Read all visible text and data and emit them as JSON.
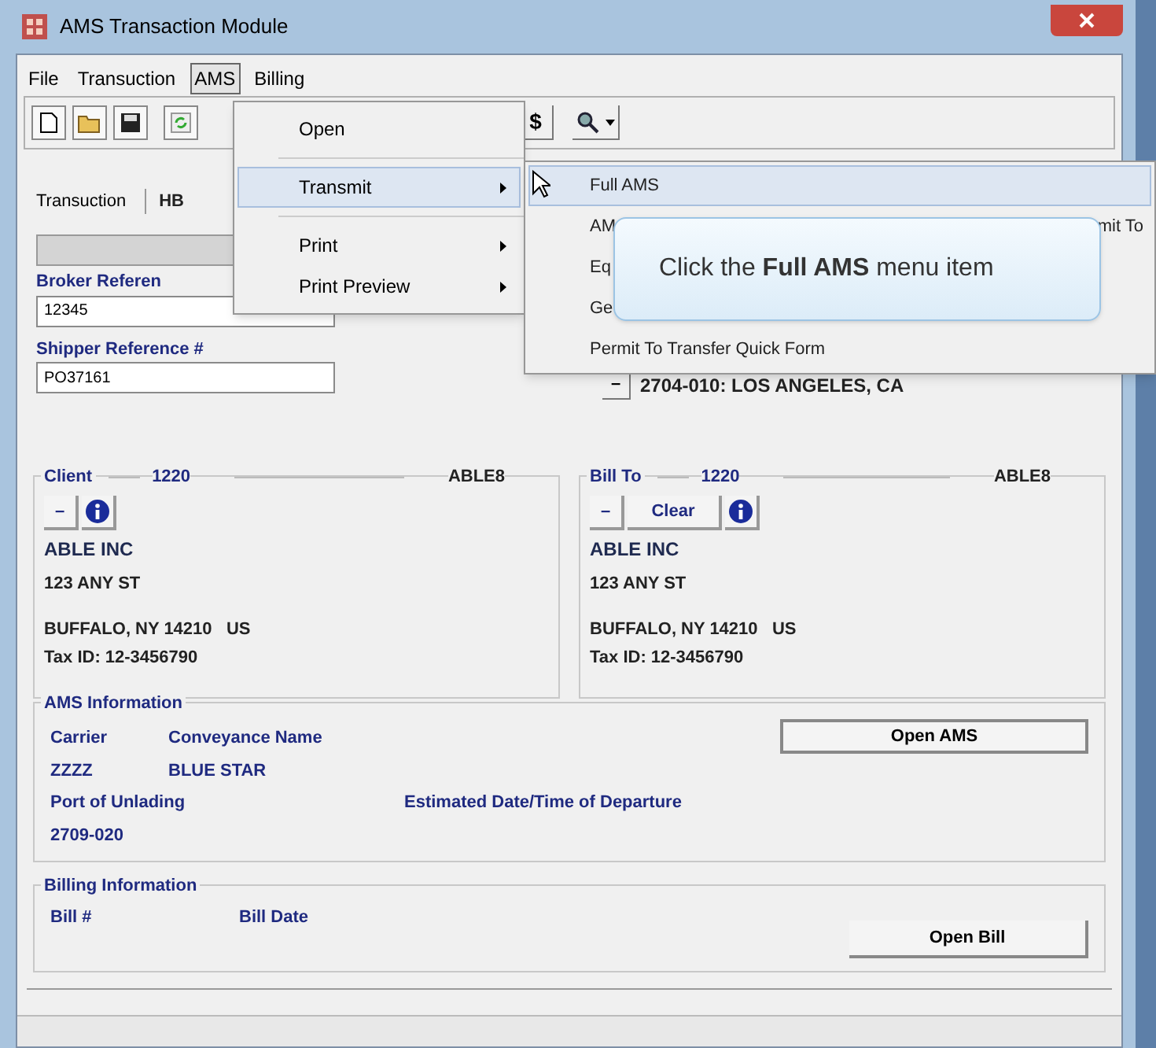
{
  "window": {
    "title": "AMS Transaction Module"
  },
  "menu_bar": [
    {
      "label": "File",
      "selected": false
    },
    {
      "label": "Transuction",
      "selected": false
    },
    {
      "label": "AMS",
      "selected": true
    },
    {
      "label": "Billing",
      "selected": false
    }
  ],
  "toolbar": {
    "currency_button": "$"
  },
  "tabs": [
    {
      "label": "Transuction",
      "selected": true
    },
    {
      "label": "HB",
      "selected": false
    }
  ],
  "broker_reference": {
    "label": "Broker Referen",
    "value": "12345"
  },
  "shipper_reference": {
    "label": "Shipper Reference #",
    "value": "PO37161"
  },
  "port": {
    "button": "–",
    "value": "2704-010: LOS ANGELES, CA"
  },
  "parties": [
    {
      "title": "Client",
      "code": "1220",
      "id": "ABLE8",
      "buttons": [
        "–"
      ],
      "name": "ABLE INC",
      "address": "123 ANY ST",
      "city": "BUFFALO, NY 14210   US",
      "tax_id": "Tax ID: 12-3456790"
    },
    {
      "title": "Bill To",
      "code": "1220",
      "id": "ABLE8",
      "buttons": [
        "–",
        "Clear"
      ],
      "name": "ABLE INC",
      "address": "123 ANY ST",
      "city": "BUFFALO, NY 14210   US",
      "tax_id": "Tax ID: 12-3456790"
    }
  ],
  "ams_information": {
    "title": "AMS Information",
    "carrier_label": "Carrier",
    "conveyance_label": "Conveyance Name",
    "carrier": "ZZZZ",
    "conveyance": "BLUE STAR",
    "port_label": "Port of Unlading",
    "departure_label": "Estimated Date/Time of Departure",
    "port": "2709-020",
    "button": "Open AMS"
  },
  "billing_information": {
    "title": "Billing Information",
    "bill_label": "Bill #",
    "date_label": "Bill Date",
    "button": "Open Bill"
  },
  "menu": [
    {
      "kind": "item",
      "label": "Open",
      "selected": false,
      "submenu": false
    },
    {
      "kind": "separator"
    },
    {
      "kind": "item",
      "label": "Transmit",
      "selected": true,
      "submenu": true
    },
    {
      "kind": "separator"
    },
    {
      "kind": "item",
      "label": "Print",
      "selected": false,
      "submenu": true
    },
    {
      "kind": "item",
      "label": "Print Preview",
      "selected": false,
      "submenu": true
    }
  ],
  "submenu": [
    {
      "label": "Full AMS",
      "selected": true
    },
    {
      "label": "AM",
      "trailing": "mit To",
      "selected": false
    },
    {
      "label": "Eq",
      "selected": false
    },
    {
      "label": "Ge",
      "selected": false
    },
    {
      "label": "Permit To Transfer Quick Form",
      "selected": false
    }
  ],
  "tooltip": "Click the **Full AMS** menu item"
}
